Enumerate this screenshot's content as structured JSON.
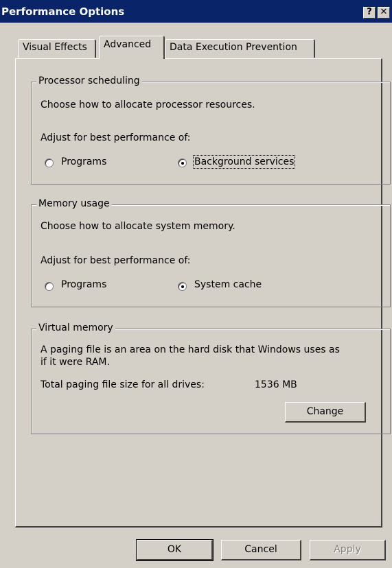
{
  "window": {
    "title": "Performance Options",
    "help_glyph": "?",
    "close_glyph": "✕"
  },
  "tabs": [
    {
      "label": "Visual Effects",
      "selected": false
    },
    {
      "label": "Advanced",
      "selected": true
    },
    {
      "label": "Data Execution Prevention",
      "selected": false
    }
  ],
  "processor": {
    "legend": "Processor scheduling",
    "description": "Choose how to allocate processor resources.",
    "adjust": "Adjust for best performance of:",
    "option_programs": "Programs",
    "option_background": "Background services",
    "selected": "Background services"
  },
  "memory": {
    "legend": "Memory usage",
    "description": "Choose how to allocate system memory.",
    "adjust": "Adjust for best performance of:",
    "option_programs": "Programs",
    "option_cache": "System cache",
    "selected": "System cache"
  },
  "virtual_memory": {
    "legend": "Virtual memory",
    "description_line1": "A paging file is an area on the hard disk that Windows uses as",
    "description_line2": "if it were RAM.",
    "total_label": "Total paging file size for all drives:",
    "total_value": "1536 MB",
    "change_button": "Change"
  },
  "footer": {
    "ok": "OK",
    "cancel": "Cancel",
    "apply": "Apply",
    "apply_enabled": false
  },
  "colors": {
    "title_bar": "#0a246a",
    "face": "#d4d0c8"
  }
}
